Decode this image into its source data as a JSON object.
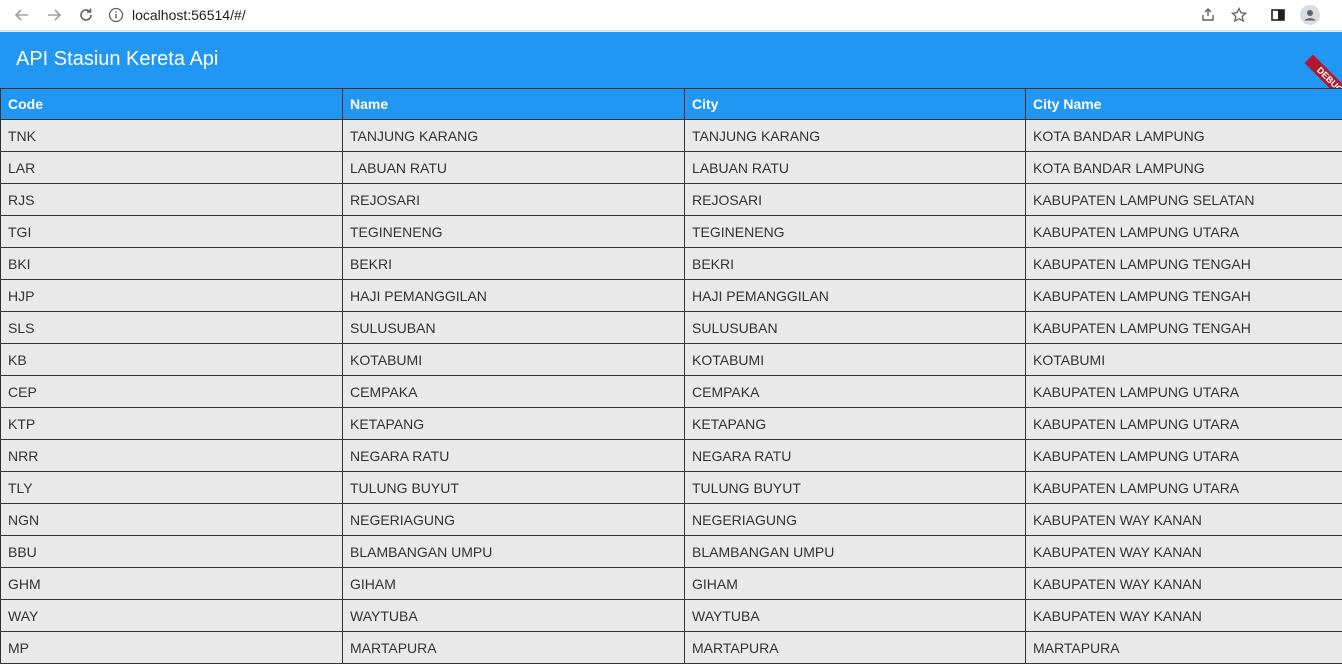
{
  "browser": {
    "url": "localhost:56514/#/"
  },
  "app": {
    "title": "API Stasiun Kereta Api",
    "debug_label": "DEBUG",
    "accent_color": "#2196f3"
  },
  "table": {
    "headers": [
      "Code",
      "Name",
      "City",
      "City Name"
    ],
    "rows": [
      [
        "TNK",
        "TANJUNG KARANG",
        "TANJUNG KARANG",
        "KOTA BANDAR LAMPUNG"
      ],
      [
        "LAR",
        "LABUAN RATU",
        "LABUAN RATU",
        "KOTA BANDAR LAMPUNG"
      ],
      [
        "RJS",
        "REJOSARI",
        "REJOSARI",
        "KABUPATEN LAMPUNG SELATAN"
      ],
      [
        "TGI",
        "TEGINENENG",
        "TEGINENENG",
        "KABUPATEN LAMPUNG UTARA"
      ],
      [
        "BKI",
        "BEKRI",
        "BEKRI",
        "KABUPATEN LAMPUNG TENGAH"
      ],
      [
        "HJP",
        "HAJI PEMANGGILAN",
        "HAJI PEMANGGILAN",
        "KABUPATEN LAMPUNG TENGAH"
      ],
      [
        "SLS",
        "SULUSUBAN",
        "SULUSUBAN",
        "KABUPATEN LAMPUNG TENGAH"
      ],
      [
        "KB",
        "KOTABUMI",
        "KOTABUMI",
        "KOTABUMI"
      ],
      [
        "CEP",
        "CEMPAKA",
        "CEMPAKA",
        "KABUPATEN LAMPUNG UTARA"
      ],
      [
        "KTP",
        "KETAPANG",
        "KETAPANG",
        "KABUPATEN LAMPUNG UTARA"
      ],
      [
        "NRR",
        "NEGARA RATU",
        "NEGARA RATU",
        "KABUPATEN LAMPUNG UTARA"
      ],
      [
        "TLY",
        "TULUNG BUYUT",
        "TULUNG BUYUT",
        "KABUPATEN LAMPUNG UTARA"
      ],
      [
        "NGN",
        "NEGERIAGUNG",
        "NEGERIAGUNG",
        "KABUPATEN WAY KANAN"
      ],
      [
        "BBU",
        "BLAMBANGAN UMPU",
        "BLAMBANGAN UMPU",
        "KABUPATEN WAY KANAN"
      ],
      [
        "GHM",
        "GIHAM",
        "GIHAM",
        "KABUPATEN WAY KANAN"
      ],
      [
        "WAY",
        "WAYTUBA",
        "WAYTUBA",
        "KABUPATEN WAY KANAN"
      ],
      [
        "MP",
        "MARTAPURA",
        "MARTAPURA",
        "MARTAPURA"
      ]
    ]
  }
}
